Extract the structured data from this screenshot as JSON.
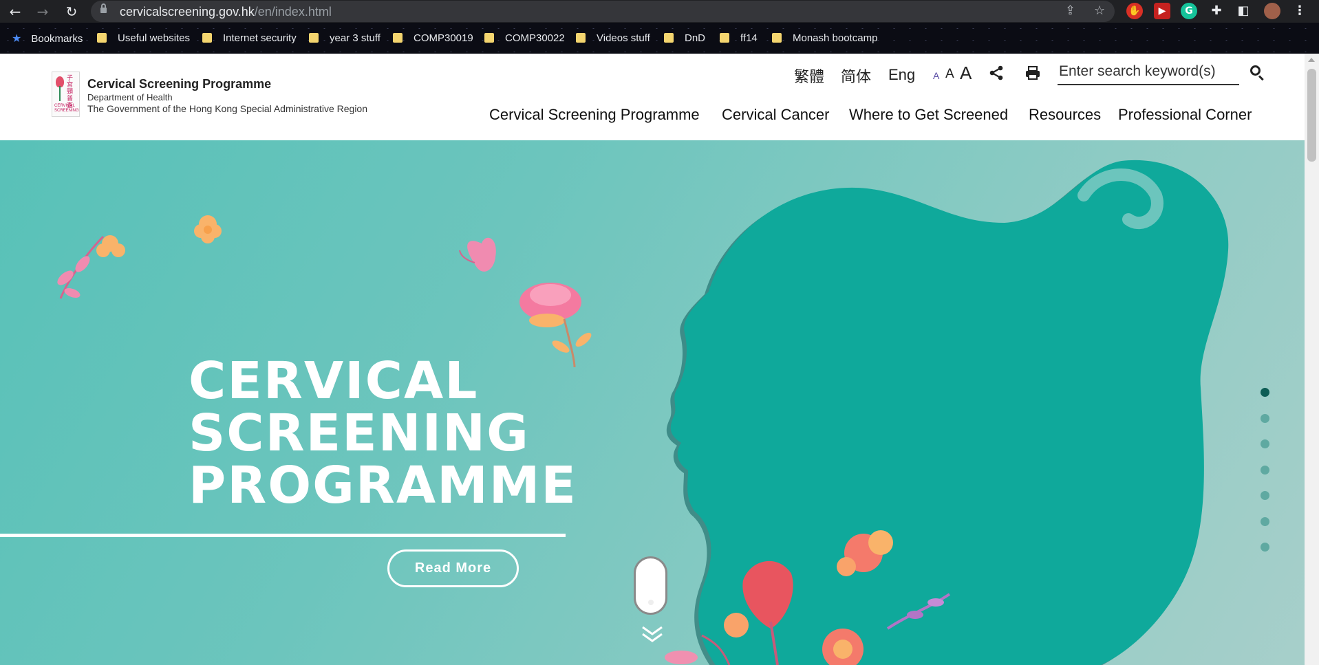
{
  "browser": {
    "url_host": "cervicalscreening.gov.hk",
    "url_path": "/en/index.html",
    "bookmarks": [
      {
        "label": "Bookmarks",
        "icon": "star-icon"
      },
      {
        "label": "Useful websites",
        "icon": "folder-icon"
      },
      {
        "label": "Internet security",
        "icon": "folder-icon"
      },
      {
        "label": "year 3 stuff",
        "icon": "folder-icon"
      },
      {
        "label": "COMP30019",
        "icon": "folder-icon"
      },
      {
        "label": "COMP30022",
        "icon": "folder-icon"
      },
      {
        "label": "Videos stuff",
        "icon": "folder-icon"
      },
      {
        "label": "DnD",
        "icon": "folder-icon"
      },
      {
        "label": "ff14",
        "icon": "folder-icon"
      },
      {
        "label": "Monash bootcamp",
        "icon": "folder-icon"
      }
    ]
  },
  "header": {
    "logo": {
      "title": "Cervical Screening Programme",
      "sub1": "Department of Health",
      "sub2": "The Government of the Hong Kong Special Administrative Region"
    },
    "languages": [
      "繁體",
      "简体",
      "Eng"
    ],
    "font_sizes": [
      "A",
      "A",
      "A"
    ],
    "search": {
      "placeholder": "Enter search keyword(s)"
    },
    "nav": [
      "Cervical Screening Programme",
      "Cervical Cancer",
      "Where to Get Screened",
      "Resources",
      "Professional Corner"
    ]
  },
  "hero": {
    "title_lines": [
      "CERVICAL",
      "SCREENING",
      "PROGRAMME"
    ],
    "read_more": "Read More",
    "slide_count": 7,
    "active_slide": 1,
    "colors": {
      "background": "#6cc5bd",
      "silhouette": "#0fa99b",
      "active_dot": "#0d5d55",
      "dot": "#5fa9a1"
    }
  }
}
